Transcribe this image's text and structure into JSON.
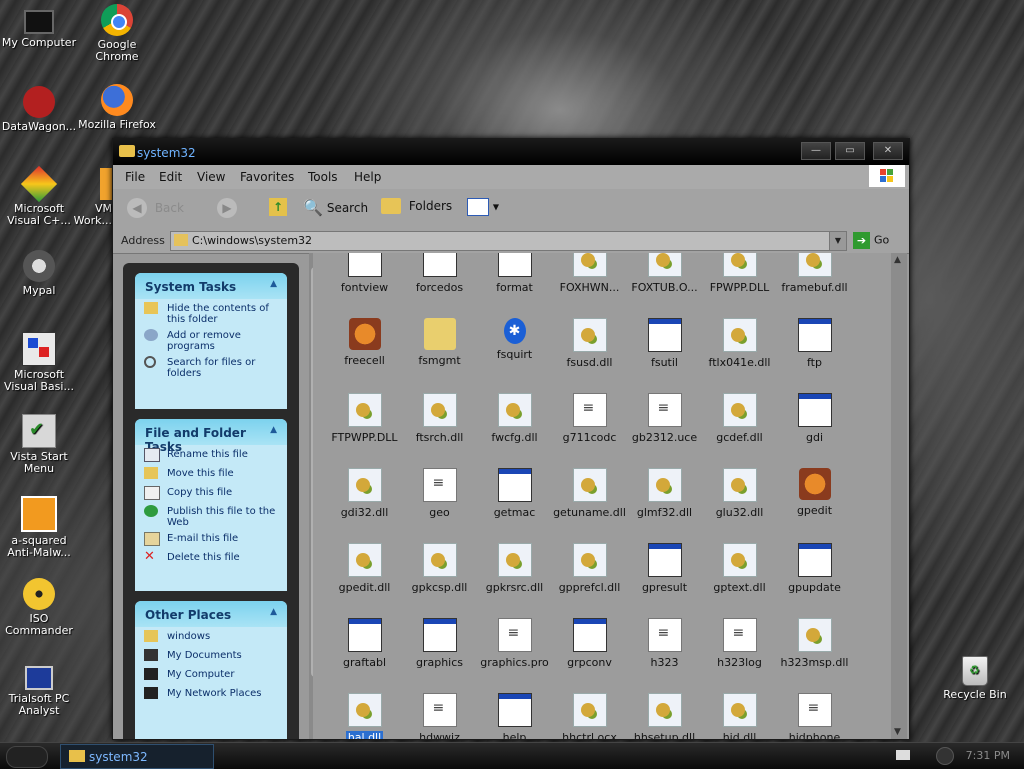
{
  "desktop": {
    "icons": [
      {
        "label": "My Computer"
      },
      {
        "label": "Google Chrome"
      },
      {
        "label": "DataWagon..."
      },
      {
        "label": "Mozilla Firefox"
      },
      {
        "label": "Microsoft Visual C+..."
      },
      {
        "label": "VM Work..."
      },
      {
        "label": "Mypal"
      },
      {
        "label": "Microsoft Visual Basi..."
      },
      {
        "label": "Vista Start Menu"
      },
      {
        "label": "a-squared Anti-Malw..."
      },
      {
        "label": "ISO Commander"
      },
      {
        "label": "Trialsoft PC Analyst"
      },
      {
        "label": "Recycle Bin"
      }
    ]
  },
  "window": {
    "title": "system32",
    "menu": [
      "File",
      "Edit",
      "View",
      "Favorites",
      "Tools",
      "Help"
    ],
    "toolbar": {
      "back": "Back",
      "search": "Search",
      "folders": "Folders"
    },
    "address": {
      "label": "Address",
      "value": "C:\\windows\\system32",
      "go": "Go"
    }
  },
  "taskpane": {
    "system_tasks": {
      "title": "System Tasks",
      "items": [
        "Hide the contents of this folder",
        "Add or remove programs",
        "Search for files or folders"
      ]
    },
    "file_tasks": {
      "title": "File and Folder Tasks",
      "items": [
        "Rename this file",
        "Move this file",
        "Copy this file",
        "Publish this file to the Web",
        "E-mail this file",
        "Delete this file"
      ]
    },
    "other_places": {
      "title": "Other Places",
      "items": [
        "windows",
        "My Documents",
        "My Computer",
        "My Network Places"
      ]
    }
  },
  "files": [
    {
      "name": "fontview",
      "type": "exe"
    },
    {
      "name": "forcedos",
      "type": "exe"
    },
    {
      "name": "format",
      "type": "exe"
    },
    {
      "name": "FOXHWN...",
      "type": "dll"
    },
    {
      "name": "FOXTUB.O...",
      "type": "dll"
    },
    {
      "name": "FPWPP.DLL",
      "type": "dll"
    },
    {
      "name": "framebuf.dll",
      "type": "dll"
    },
    {
      "name": "freecell",
      "type": "app"
    },
    {
      "name": "fsmgmt",
      "type": "folder"
    },
    {
      "name": "fsquirt",
      "type": "bt"
    },
    {
      "name": "fsusd.dll",
      "type": "dll"
    },
    {
      "name": "fsutil",
      "type": "exe"
    },
    {
      "name": "ftlx041e.dll",
      "type": "dll"
    },
    {
      "name": "ftp",
      "type": "exe"
    },
    {
      "name": "FTPWPP.DLL",
      "type": "dll"
    },
    {
      "name": "ftsrch.dll",
      "type": "dll"
    },
    {
      "name": "fwcfg.dll",
      "type": "dll"
    },
    {
      "name": "g711codc",
      "type": "doc"
    },
    {
      "name": "gb2312.uce",
      "type": "doc"
    },
    {
      "name": "gcdef.dll",
      "type": "dll"
    },
    {
      "name": "gdi",
      "type": "exe"
    },
    {
      "name": "gdi32.dll",
      "type": "dll"
    },
    {
      "name": "geo",
      "type": "doc"
    },
    {
      "name": "getmac",
      "type": "exe"
    },
    {
      "name": "getuname.dll",
      "type": "dll"
    },
    {
      "name": "glmf32.dll",
      "type": "dll"
    },
    {
      "name": "glu32.dll",
      "type": "dll"
    },
    {
      "name": "gpedit",
      "type": "app"
    },
    {
      "name": "gpedit.dll",
      "type": "dll"
    },
    {
      "name": "gpkcsp.dll",
      "type": "dll"
    },
    {
      "name": "gpkrsrc.dll",
      "type": "dll"
    },
    {
      "name": "gpprefcl.dll",
      "type": "dll"
    },
    {
      "name": "gpresult",
      "type": "exe"
    },
    {
      "name": "gptext.dll",
      "type": "dll"
    },
    {
      "name": "gpupdate",
      "type": "exe"
    },
    {
      "name": "graftabl",
      "type": "exe"
    },
    {
      "name": "graphics",
      "type": "exe"
    },
    {
      "name": "graphics.pro",
      "type": "doc"
    },
    {
      "name": "grpconv",
      "type": "exe"
    },
    {
      "name": "h323",
      "type": "doc"
    },
    {
      "name": "h323log",
      "type": "doc"
    },
    {
      "name": "h323msp.dll",
      "type": "dll"
    },
    {
      "name": "hal.dll",
      "type": "dll",
      "selected": true
    },
    {
      "name": "hdwwiz",
      "type": "doc"
    },
    {
      "name": "help",
      "type": "exe"
    },
    {
      "name": "hhctrl.ocx",
      "type": "dll"
    },
    {
      "name": "hhsetup.dll",
      "type": "dll"
    },
    {
      "name": "hid.dll",
      "type": "dll"
    },
    {
      "name": "hidphone",
      "type": "doc"
    }
  ],
  "taskbar": {
    "window_button": "system32",
    "clock": "7:31 PM"
  }
}
